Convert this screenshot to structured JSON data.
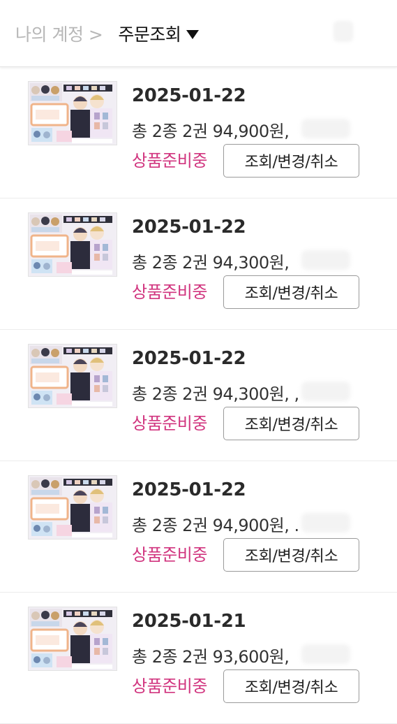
{
  "header": {
    "breadcrumb": "나의 계정 >",
    "title": "주문조회"
  },
  "orders": [
    {
      "date": "2025-01-22",
      "summary": "총 2종 2권 94,900원,",
      "status": "상품준비중",
      "action": "조회/변경/취소"
    },
    {
      "date": "2025-01-22",
      "summary": "총 2종 2권 94,300원,",
      "status": "상품준비중",
      "action": "조회/변경/취소"
    },
    {
      "date": "2025-01-22",
      "summary": "총 2종 2권 94,300원, ,",
      "status": "상품준비중",
      "action": "조회/변경/취소"
    },
    {
      "date": "2025-01-22",
      "summary": "총 2종 2권 94,900원, .",
      "status": "상품준비중",
      "action": "조회/변경/취소"
    },
    {
      "date": "2025-01-21",
      "summary": "총 2종 2권 93,600원,",
      "status": "상품준비중",
      "action": "조회/변경/취소"
    }
  ],
  "colors": {
    "status": "#d1357f",
    "breadcrumb": "#b7b7b7"
  }
}
